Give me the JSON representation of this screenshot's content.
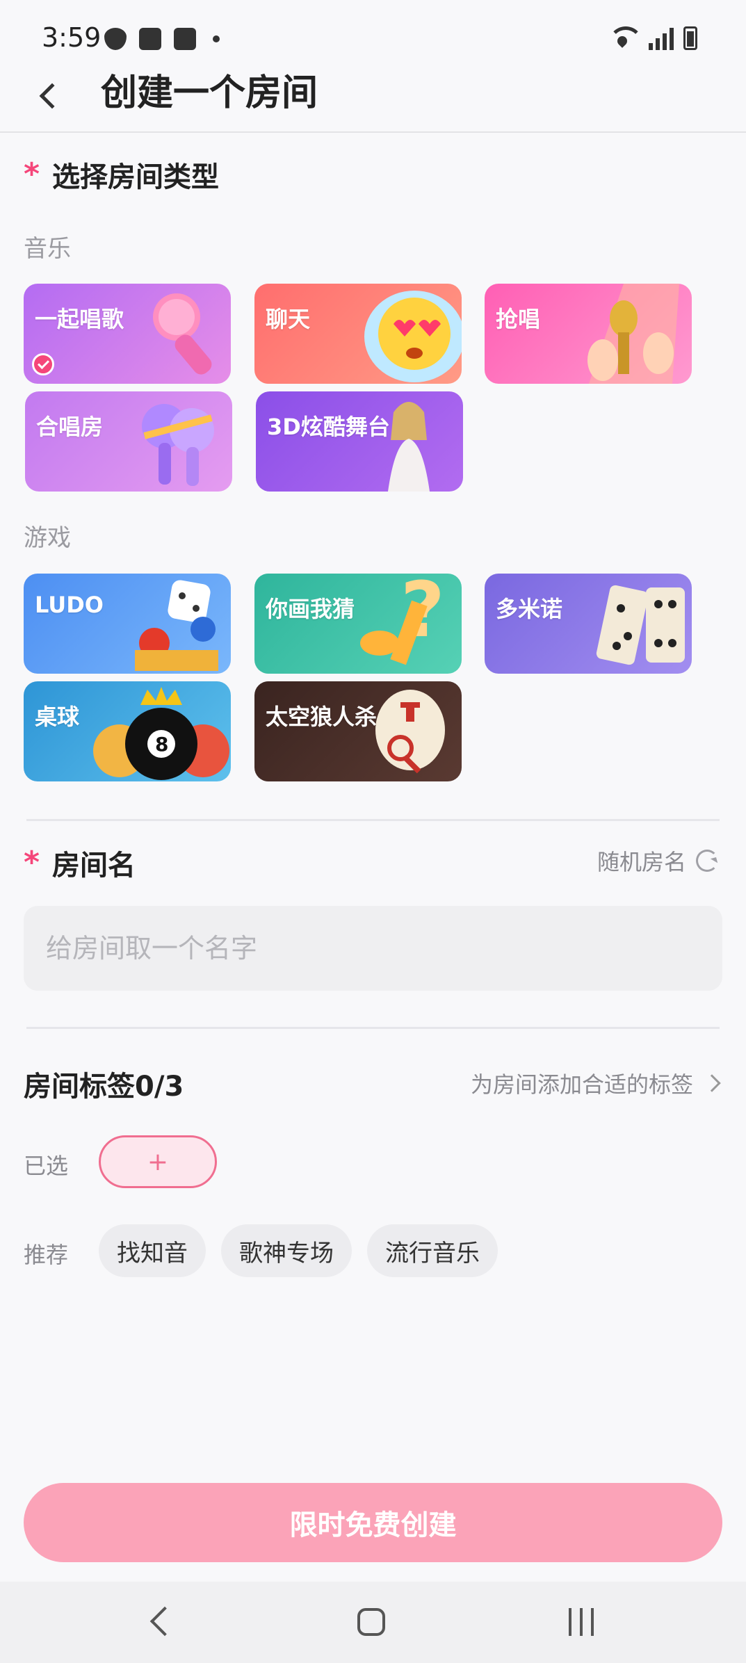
{
  "status_bar": {
    "time": "3:59"
  },
  "header": {
    "title": "创建一个房间"
  },
  "room_type": {
    "title": "选择房间类型",
    "required_mark": "*",
    "music_label": "音乐",
    "music": [
      {
        "label": "一起唱歌",
        "selected": true,
        "color1": "#b46cf2",
        "color2": "#e68ee8"
      },
      {
        "label": "聊天",
        "selected": false,
        "color1": "#ff6e6e",
        "color2": "#ff9b86"
      },
      {
        "label": "抢唱",
        "selected": false,
        "color1": "#ff5fb4",
        "color2": "#ff9ad0"
      },
      {
        "label": "合唱房",
        "selected": false,
        "color1": "#c27af0",
        "color2": "#e59cf0"
      },
      {
        "label": "3D炫酷舞台",
        "selected": false,
        "color1": "#8b4fe8",
        "color2": "#b26cf0"
      }
    ],
    "games_label": "游戏",
    "games": [
      {
        "label": "LUDO",
        "color1": "#4d8ff2",
        "color2": "#7ab7fb"
      },
      {
        "label": "你画我猜",
        "color1": "#2fb59c",
        "color2": "#56d1b5"
      },
      {
        "label": "多米诺",
        "color1": "#7a68e0",
        "color2": "#a28ef0"
      },
      {
        "label": "桌球",
        "color1": "#2e95d6",
        "color2": "#5ec0ec"
      },
      {
        "label": "太空狼人杀",
        "color1": "#3a2420",
        "color2": "#5a3a32"
      }
    ]
  },
  "room_name": {
    "title": "房间名",
    "required_mark": "*",
    "random_label": "随机房名",
    "placeholder": "给房间取一个名字",
    "value": ""
  },
  "room_tags": {
    "title": "房间标签0/3",
    "add_link": "为房间添加合适的标签",
    "selected_label": "已选",
    "add_button": "+",
    "recommended_label": "推荐",
    "recommended": [
      "找知音",
      "歌神专场",
      "流行音乐"
    ]
  },
  "create_button": "限时免费创建",
  "colors": {
    "accent": "#f5467a",
    "create_button": "#fba3b8"
  }
}
